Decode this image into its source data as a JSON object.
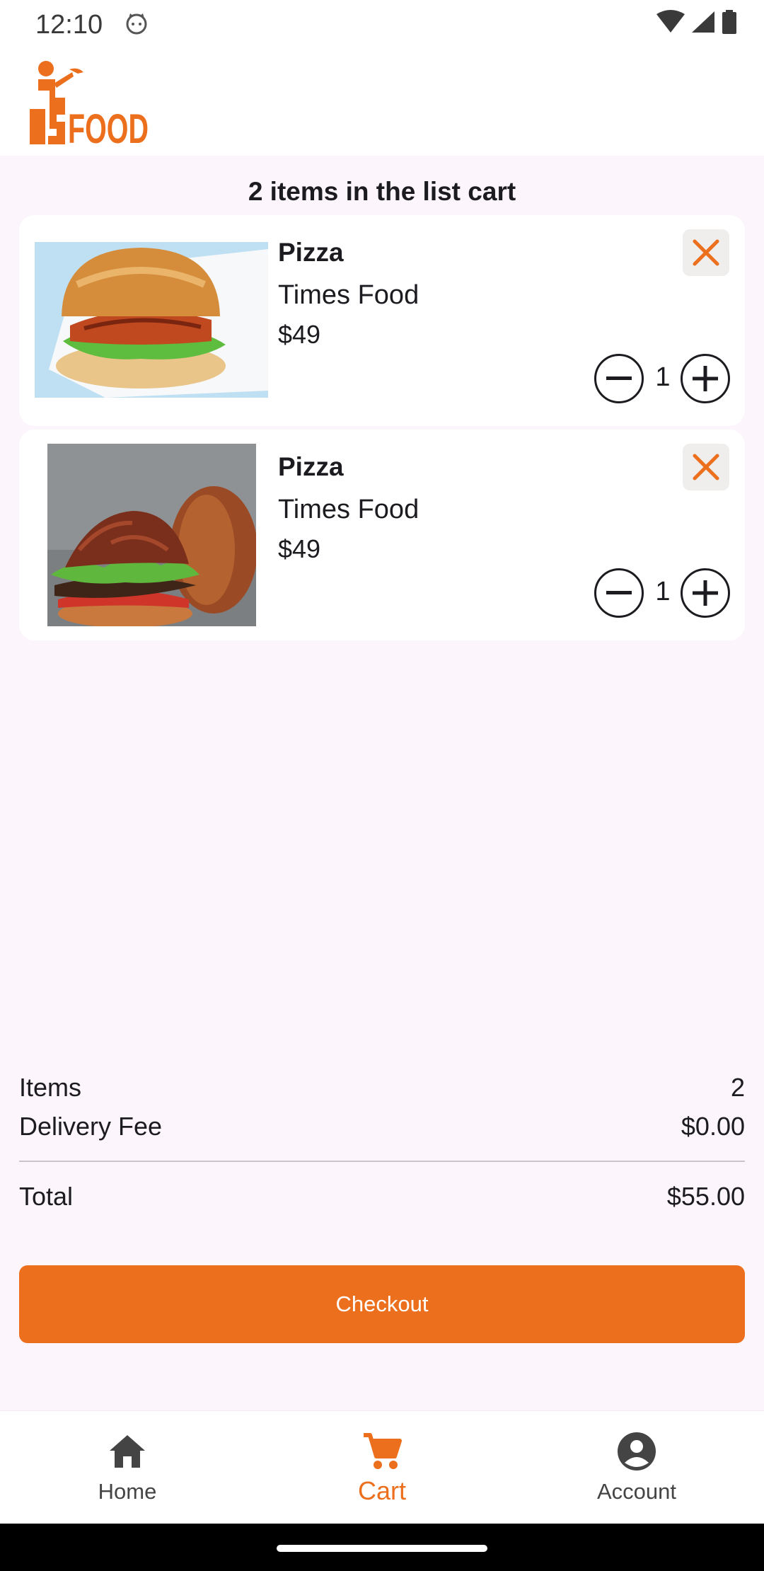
{
  "status_bar": {
    "time": "12:10"
  },
  "app_bar": {
    "logo_text": "FOOD",
    "brand_color": "#ec6f1e"
  },
  "cart": {
    "header": "2 items in the list cart",
    "items": [
      {
        "name": "Pizza",
        "store": "Times Food",
        "price": "$49",
        "quantity": "1",
        "image": "salmon-burger"
      },
      {
        "name": "Pizza",
        "store": "Times Food",
        "price": "$49",
        "quantity": "1",
        "image": "pulled-pork-burger"
      }
    ]
  },
  "summary": {
    "items_label": "Items",
    "items_value": "2",
    "fee_label": "Delivery Fee",
    "fee_value": "$0.00",
    "total_label": "Total",
    "total_value": "$55.00"
  },
  "checkout_label": "Checkout",
  "bottom_nav": {
    "items": [
      {
        "label": "Home",
        "icon": "home-icon"
      },
      {
        "label": "Cart",
        "icon": "cart-icon",
        "active": true
      },
      {
        "label": "Account",
        "icon": "account-icon"
      }
    ]
  },
  "colors": {
    "accent": "#ec6f1e",
    "background": "#fcf5fb",
    "card": "#ffffff"
  }
}
